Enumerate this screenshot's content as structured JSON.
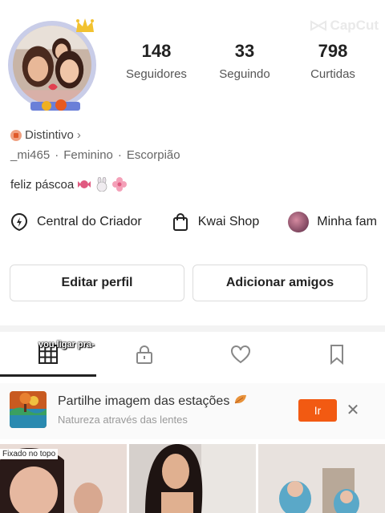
{
  "watermark": {
    "text": "CapCut",
    "icon": "capcut-logo-icon"
  },
  "profile": {
    "avatar_icon": "profile-avatar",
    "stats": [
      {
        "value": "148",
        "label": "Seguidores"
      },
      {
        "value": "33",
        "label": "Seguindo"
      },
      {
        "value": "798",
        "label": "Curtidas"
      }
    ],
    "badge": {
      "label": "Distintivo",
      "chevron": "›"
    },
    "meta": {
      "username": "_mi465",
      "gender": "Feminino",
      "sign": "Escorpião",
      "separator": "·"
    },
    "bio": {
      "text": "feliz páscoa"
    }
  },
  "shortcuts": [
    {
      "label": "Central do Criador",
      "icon": "lightning-icon"
    },
    {
      "label": "Kwai Shop",
      "icon": "shopping-bag-icon"
    },
    {
      "label": "Minha fam",
      "icon": "family-avatar-icon"
    }
  ],
  "buttons": {
    "edit": "Editar perfil",
    "add_friends": "Adicionar amigos"
  },
  "tabs": [
    {
      "name": "grid",
      "icon": "grid-icon",
      "active": true
    },
    {
      "name": "private",
      "icon": "lock-icon",
      "active": false
    },
    {
      "name": "liked",
      "icon": "heart-icon",
      "active": false
    },
    {
      "name": "saved",
      "icon": "bookmark-icon",
      "active": false
    }
  ],
  "caption": "vou ligar pra-",
  "banner": {
    "title": "Partilhe imagem das estações",
    "subtitle": "Natureza através das lentes",
    "action": "Ir",
    "close": "✕"
  },
  "grid": {
    "pinned_label": "Fixado no topo"
  },
  "colors": {
    "accent": "#f25a12",
    "text": "#222222",
    "muted": "#666666",
    "divider": "#f3f3f3"
  }
}
